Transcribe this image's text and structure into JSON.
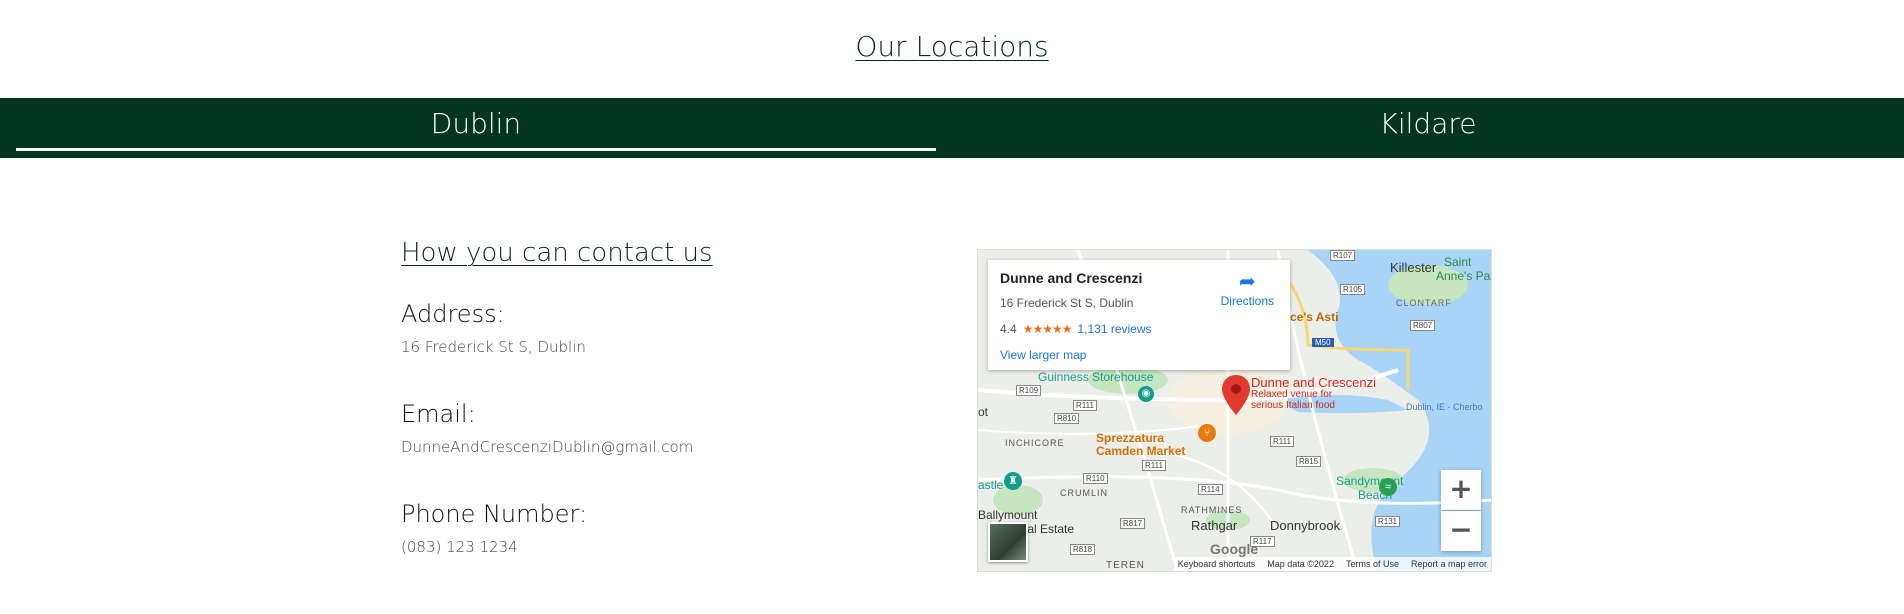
{
  "page": {
    "title": "Our Locations"
  },
  "tabs": [
    {
      "label": "Dublin",
      "active": true
    },
    {
      "label": "Kildare",
      "active": false
    }
  ],
  "contact": {
    "heading": "How you can contact us",
    "address_label": "Address:",
    "address_value": "16 Frederick St S, Dublin",
    "email_label": "Email:",
    "email_value": "DunneAndCrescenziDublin@gmail.com",
    "phone_label": "Phone Number:",
    "phone_value": "(083) 123 1234"
  },
  "map": {
    "info": {
      "name": "Dunne and Crescenzi",
      "address": "16 Frederick St S, Dublin",
      "rating": "4.4",
      "stars": "★★★★★",
      "reviews": "1,131 reviews",
      "larger_map": "View larger map",
      "directions": "Directions"
    },
    "labels": {
      "killester": "Killester",
      "saint_annes": "Saint",
      "saint_annes2": "Anne's Park",
      "clontarf": "CLONTARF",
      "guinness": "Guinness Storehouse",
      "pin_title": "Dunne and Crescenzi",
      "pin_sub1": "Relaxed venue for",
      "pin_sub2": "serious Italian food",
      "sprezzatura": "Sprezzatura",
      "camden": "Camden Market",
      "inchicore": "INCHICORE",
      "crumlin": "CRUMLIN",
      "rathmines": "RATHMINES",
      "rathgar": "Rathgar",
      "donnybrook": "Donnybrook",
      "sandymount": "Sandymount",
      "beach": "Beach",
      "ballymount": "Ballymount",
      "estate": "Industrial Estate",
      "dublin_port": "Dublin, IE - Cherbo",
      "astle": "astle",
      "ot": "ot",
      "ces_asti": "ce's Asti",
      "teren": "TEREN",
      "m50": "M50",
      "r107": "R107",
      "r105": "R105",
      "r807": "R807",
      "r109": "R109",
      "r111": "R111",
      "r810": "R810",
      "r111b": "R111",
      "r815": "R815",
      "r110": "R110",
      "r114": "R114",
      "r817": "R817",
      "r117": "R117",
      "r818": "R818",
      "r131": "R131",
      "r111c": "R111"
    },
    "zoom_in": "+",
    "zoom_out": "−",
    "google": "Google",
    "attribution": {
      "shortcuts": "Keyboard shortcuts",
      "data": "Map data ©2022",
      "terms": "Terms of Use",
      "report": "Report a map error"
    },
    "colors": {
      "water": "#a8d4f5",
      "park": "#c6e6c0",
      "land": "#eceeea",
      "road_major": "#f7d677",
      "pin": "#e03b2e",
      "poi_orange": "#e8790e",
      "poi_teal": "#139e8c"
    }
  },
  "theme": {
    "tab_bar": "#033520",
    "heading_color": "#0a2a17"
  }
}
